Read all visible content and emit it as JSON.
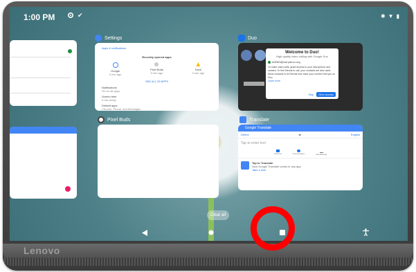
{
  "device": {
    "brand": "Lenovo"
  },
  "statusbar": {
    "time": "1:00 PM"
  },
  "recents": {
    "settings": {
      "app_name": "Settings",
      "header": "Apps & notifications",
      "recent_label": "Recently opened apps",
      "apps": [
        {
          "name": "Google",
          "time": "0 min ago"
        },
        {
          "name": "Pixel Buds",
          "time": "0 min ago"
        },
        {
          "name": "Drive",
          "time": "0 min ago"
        }
      ],
      "see_all": "SEE ALL 33 APPS",
      "items": [
        {
          "title": "Notifications",
          "sub": "On for all apps"
        },
        {
          "title": "Screen time",
          "sub": "0 min today"
        },
        {
          "title": "Default apps",
          "sub": "Chrome, Phone, and Messages"
        }
      ]
    },
    "duo": {
      "app_name": "Duo",
      "dialog_title": "Welcome to Duo!",
      "dialog_sub": "High quality video calling with Google Duo",
      "email": "lic5363@sal.yahoo.org",
      "body": "To make video calls, grant access to your microphone and camera. To find friends to call, your contacts are also used. Allow contacts to let friends who have your number find you on Duo.",
      "learn_more": "Learn more",
      "later": "Skip",
      "continue": "Give access"
    },
    "pixel_buds": {
      "app_name": "Pixel Buds"
    },
    "translate": {
      "app_name": "Translate",
      "title": "Google Translate",
      "from": "Detect",
      "to": "English",
      "placeholder": "Tap to enter text",
      "actions": [
        "Camera",
        "Conversation",
        "Handwriting"
      ],
      "tip_title": "Tap to Translate",
      "tip_body": "Now Google Translate works in any app",
      "tip_link": "Take a look"
    }
  },
  "clear_all": "Clear all",
  "colors": {
    "highlight": "#ff0000",
    "google_blue": "#4285f4",
    "duo_blue": "#1a73e8"
  }
}
